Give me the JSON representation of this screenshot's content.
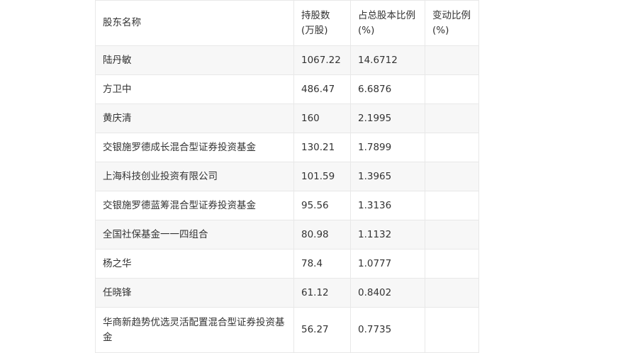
{
  "table": {
    "headers": [
      "股东名称",
      "持股数(万股)",
      "占总股本比例(%)",
      "变动比例(%)"
    ],
    "rows": [
      [
        "陆丹敏",
        "1067.22",
        "14.6712",
        ""
      ],
      [
        "方卫中",
        "486.47",
        "6.6876",
        ""
      ],
      [
        "黄庆清",
        "160",
        "2.1995",
        ""
      ],
      [
        "交银施罗德成长混合型证券投资基金",
        "130.21",
        "1.7899",
        ""
      ],
      [
        "上海科技创业投资有限公司",
        "101.59",
        "1.3965",
        ""
      ],
      [
        "交银施罗德蓝筹混合型证券投资基金",
        "95.56",
        "1.3136",
        ""
      ],
      [
        "全国社保基金一一四组合",
        "80.98",
        "1.1132",
        ""
      ],
      [
        "杨之华",
        "78.4",
        "1.0777",
        ""
      ],
      [
        "任晓锋",
        "61.12",
        "0.8402",
        ""
      ],
      [
        "华商新趋势优选灵活配置混合型证券投资基金",
        "56.27",
        "0.7735",
        ""
      ]
    ]
  }
}
